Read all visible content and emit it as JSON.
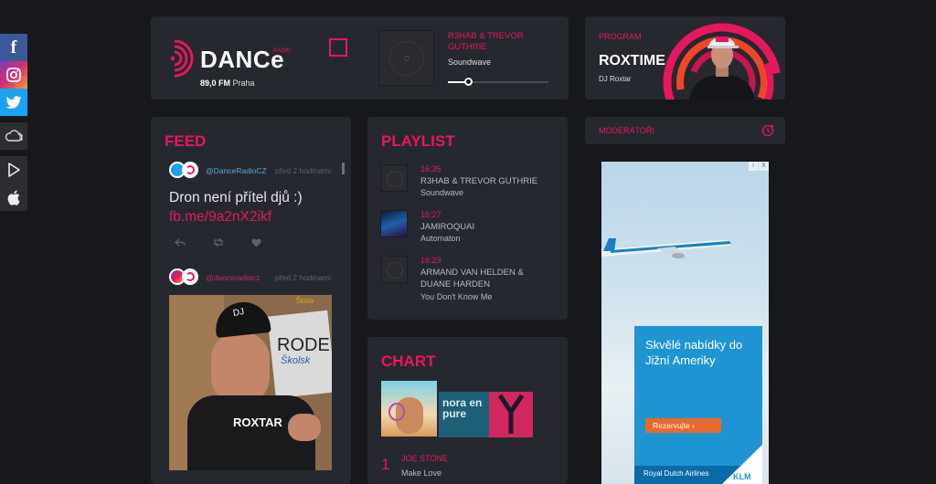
{
  "social": {
    "facebook": "f",
    "instagram": "instagram-icon",
    "twitter": "twitter-icon",
    "cloud": "cloud-icon",
    "play": "google-play-icon",
    "apple": "apple-icon"
  },
  "header": {
    "logo_text": "DANCe",
    "logo_sup": "RADIO",
    "freq": "89,0 FM",
    "city": "Praha",
    "now_artist": "R3HAB & TREVOR GUTHRIE",
    "now_title": "Soundwave",
    "volume": 0.2
  },
  "program": {
    "label": "PROGRAM",
    "show": "ROXTIME",
    "dj": "DJ Roxtar"
  },
  "moderators": {
    "label": "MODERÁTOŘI"
  },
  "feed": {
    "title": "FEED",
    "post1": {
      "handle": "@DanceRadioCZ",
      "time": "před 2 hodinami",
      "text": "Dron není přítel djů :)",
      "link": "fb.me/9a2nX2ikf"
    },
    "post2": {
      "handle": "@danceradiocz",
      "time": "před 2 hodinami",
      "img_sign1": "RODE",
      "img_sign2": "Školsk",
      "img_sign3": "Škola",
      "cap": "DJ",
      "shirt": "ROXTAR"
    }
  },
  "playlist": {
    "title": "PLAYLIST",
    "items": [
      {
        "time": "16:35",
        "artist": "R3HAB & TREVOR GUTHRIE",
        "title": "Soundwave"
      },
      {
        "time": "16:27",
        "artist": "JAMIROQUAI",
        "title": "Automaton"
      },
      {
        "time": "16:23",
        "artist": "ARMAND VAN HELDEN & DUANE HARDEN",
        "title": "You Don't Know Me"
      }
    ]
  },
  "chart": {
    "title": "CHART",
    "cover2_text": "nora en pure",
    "entries": [
      {
        "rank": "1",
        "artist": "JOE STONE",
        "title": "Make Love"
      }
    ]
  },
  "ad": {
    "headline": "Skvělé nabídky do Jižní Ameriky",
    "cta": "Rezervujte",
    "brand": "Royal Dutch Airlines",
    "logo": "KLM",
    "adchoices": "i",
    "close": "X"
  }
}
